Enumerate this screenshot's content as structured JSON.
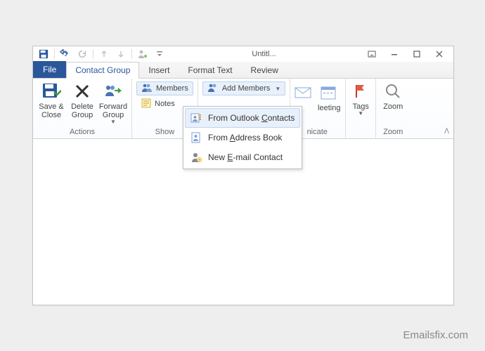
{
  "titlebar": {
    "title": "Untitl..."
  },
  "tabs": {
    "file": "File",
    "items": [
      "Contact Group",
      "Insert",
      "Format Text",
      "Review"
    ],
    "active": 0
  },
  "ribbon": {
    "actions": {
      "save_close": "Save & Close",
      "delete_group": "Delete Group",
      "forward_group": "Forward Group",
      "label": "Actions"
    },
    "show": {
      "members": "Members",
      "notes": "Notes",
      "label": "Show"
    },
    "members_group": {
      "add_members": "Add Members"
    },
    "communicate": {
      "meeting_suffix": "leeting",
      "label_suffix": "nicate"
    },
    "tags": {
      "label": "Tags"
    },
    "zoom": {
      "btn": "Zoom",
      "label": "Zoom"
    }
  },
  "dropdown": {
    "from_outlook": {
      "pre": "From Outlook ",
      "u": "C",
      "post": "ontacts"
    },
    "from_address": {
      "pre": "From ",
      "u": "A",
      "post": "ddress Book"
    },
    "new_email": {
      "pre": "New ",
      "u": "E",
      "post": "-mail Contact"
    }
  },
  "watermark": "Emailsfix.com"
}
